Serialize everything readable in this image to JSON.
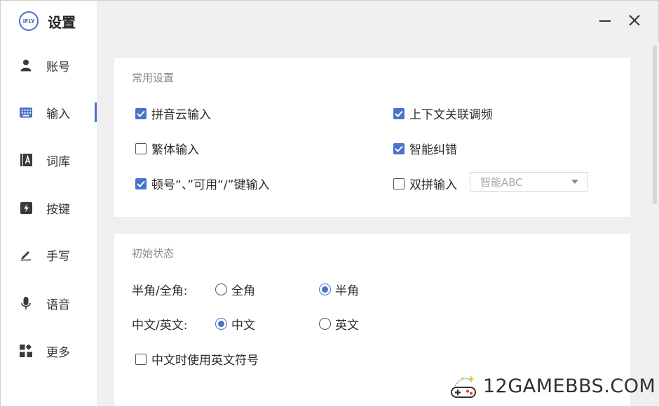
{
  "app": {
    "logo_text": "iFLY",
    "title": "设置"
  },
  "window": {
    "minimize_symbol": "—",
    "close_symbol": "✕"
  },
  "sidebar": {
    "items": [
      {
        "label": "账号",
        "icon": "user-icon",
        "active": false
      },
      {
        "label": "输入",
        "icon": "keyboard-icon",
        "active": true
      },
      {
        "label": "词库",
        "icon": "dictionary-icon",
        "active": false
      },
      {
        "label": "按键",
        "icon": "lightning-key-icon",
        "active": false
      },
      {
        "label": "手写",
        "icon": "pen-icon",
        "active": false
      },
      {
        "label": "语音",
        "icon": "microphone-icon",
        "active": false
      },
      {
        "label": "更多",
        "icon": "grid-more-icon",
        "active": false
      }
    ]
  },
  "common_settings": {
    "title": "常用设置",
    "options": [
      {
        "label": "拼音云输入",
        "checked": true
      },
      {
        "label": "上下文关联调频",
        "checked": true
      },
      {
        "label": "繁体输入",
        "checked": false
      },
      {
        "label": "智能纠错",
        "checked": true
      },
      {
        "label": "顿号“、”可用“/”键输入",
        "checked": true
      },
      {
        "label": "双拼输入",
        "checked": false
      }
    ],
    "shuangpin_scheme": {
      "value": "智能ABC"
    }
  },
  "initial_state": {
    "title": "初始状态",
    "width_row": {
      "label": "半角/全角:",
      "options": [
        {
          "label": "全角",
          "selected": false
        },
        {
          "label": "半角",
          "selected": true
        }
      ]
    },
    "lang_row": {
      "label": "中文/英文:",
      "options": [
        {
          "label": "中文",
          "selected": true
        },
        {
          "label": "英文",
          "selected": false
        }
      ]
    },
    "english_punct": {
      "label": "中文时使用英文符号",
      "checked": false
    }
  },
  "watermark": {
    "text": "12GAMEBBS.COM"
  },
  "colors": {
    "accent": "#4a73c9",
    "sidebar_bg": "#ffffff",
    "content_bg": "#efefef"
  }
}
